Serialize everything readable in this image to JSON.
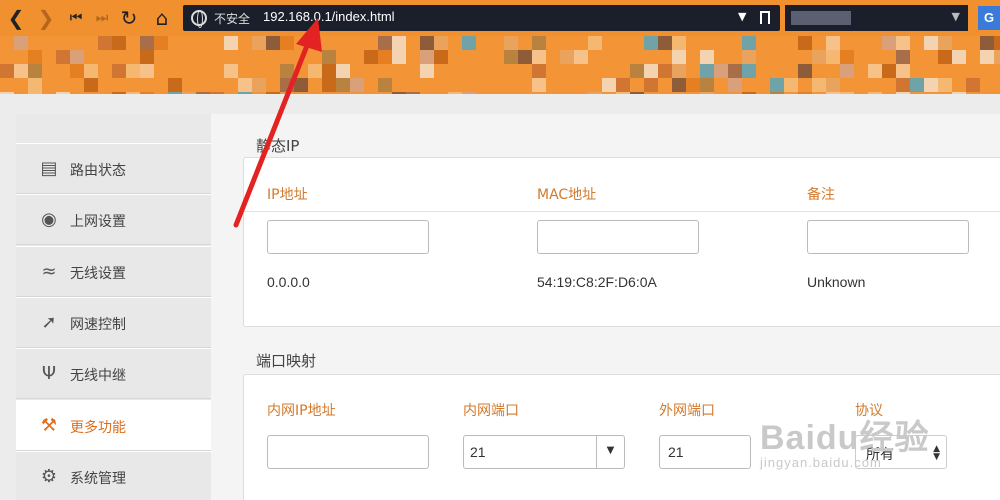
{
  "browser": {
    "insecure_label": "不安全",
    "url": "192.168.0.1/index.html",
    "translate_label": "G"
  },
  "colors": {
    "accent": "#e06d1b",
    "toolbar": "#f0902e",
    "header_label": "#d37a2c",
    "annotation": "#e32222"
  },
  "sidebar": {
    "items": [
      {
        "label": "路由状态",
        "icon": "router-icon"
      },
      {
        "label": "上网设置",
        "icon": "globe-icon"
      },
      {
        "label": "无线设置",
        "icon": "wifi-icon"
      },
      {
        "label": "网速控制",
        "icon": "speed-chart-icon"
      },
      {
        "label": "无线中继",
        "icon": "antenna-icon"
      },
      {
        "label": "更多功能",
        "icon": "tools-icon",
        "active": true
      },
      {
        "label": "系统管理",
        "icon": "gears-icon"
      }
    ]
  },
  "static_ip": {
    "title": "静态IP",
    "headers": [
      "IP地址",
      "MAC地址",
      "备注"
    ],
    "inputs": [
      "",
      "",
      ""
    ],
    "row": [
      "0.0.0.0",
      "54:19:C8:2F:D6:0A",
      "Unknown"
    ]
  },
  "port_mapping": {
    "title": "端口映射",
    "headers": [
      "内网IP地址",
      "内网端口",
      "外网端口",
      "协议"
    ],
    "ip_input": "",
    "internal_port": "21",
    "external_port": "21",
    "protocol": "所有"
  },
  "watermark": {
    "brand": "Baidu经验",
    "url": "jingyan.baidu.com"
  }
}
